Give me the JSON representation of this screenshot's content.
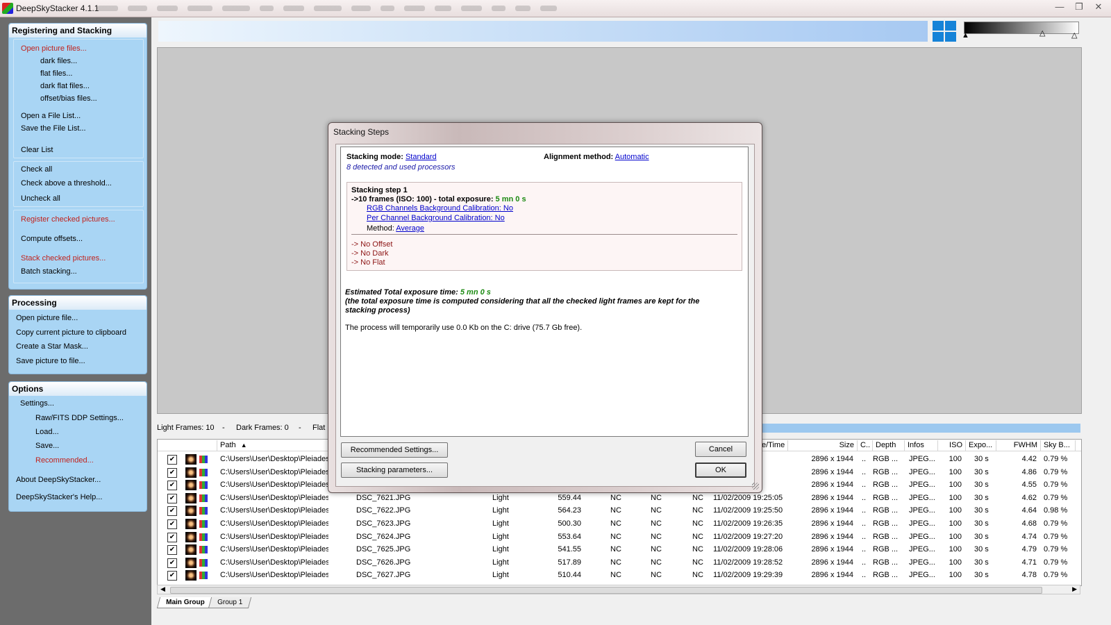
{
  "window": {
    "title": "DeepSkyStacker 4.1.1"
  },
  "sidebar": {
    "registering": {
      "title": "Registering and Stacking",
      "open_picture_files": "Open picture files...",
      "dark_files": "dark files...",
      "flat_files": "flat files...",
      "dark_flat_files": "dark flat files...",
      "offset_bias_files": "offset/bias files...",
      "open_file_list": "Open a File List...",
      "save_file_list": "Save the File List...",
      "clear_list": "Clear List",
      "check_all": "Check all",
      "check_above_threshold": "Check above a threshold...",
      "uncheck_all": "Uncheck all",
      "register_checked": "Register checked pictures...",
      "compute_offsets": "Compute offsets...",
      "stack_checked": "Stack checked pictures...",
      "batch_stacking": "Batch stacking..."
    },
    "processing": {
      "title": "Processing",
      "open_picture_file": "Open picture file...",
      "copy_to_clipboard": "Copy current picture to clipboard",
      "create_star_mask": "Create a Star Mask...",
      "save_picture": "Save picture to file..."
    },
    "options": {
      "title": "Options",
      "settings": "Settings...",
      "raw_fits": "Raw/FITS DDP Settings...",
      "load": "Load...",
      "save": "Save...",
      "recommended": "Recommended...",
      "about": "About DeepSkyStacker...",
      "help": "DeepSkyStacker's Help..."
    }
  },
  "frames_bar": {
    "light": "Light Frames: 10",
    "sep1": "-",
    "dark": "Dark Frames: 0",
    "sep2": "-",
    "flat": "Flat"
  },
  "table": {
    "headers": {
      "path": "Path",
      "datetime": "e/Time",
      "size": "Size",
      "c": "C..",
      "depth": "Depth",
      "infos": "Infos",
      "iso": "ISO",
      "expo": "Expo...",
      "fwhm": "FWHM",
      "skyb": "Sky B..."
    },
    "rows": [
      {
        "path": "C:\\Users\\User\\Desktop\\Pleiades\\",
        "file": "",
        "type": "",
        "score": "",
        "dx": "",
        "dy": "",
        "angle": "",
        "date": "22:31",
        "size": "2896 x 1944",
        "c": "..",
        "depth": "RGB ...",
        "infos": "JPEG...",
        "iso": "100",
        "expo": "30 s",
        "fwhm": "4.42",
        "skyb": "0.79 %"
      },
      {
        "path": "C:\\Users\\User\\Desktop\\Pleiades\\",
        "file": "",
        "type": "",
        "score": "",
        "dx": "",
        "dy": "",
        "angle": "",
        "date": "23:34",
        "size": "2896 x 1944",
        "c": "..",
        "depth": "RGB ...",
        "infos": "JPEG...",
        "iso": "100",
        "expo": "30 s",
        "fwhm": "4.86",
        "skyb": "0.79 %"
      },
      {
        "path": "C:\\Users\\User\\Desktop\\Pleiades\\",
        "file": "",
        "type": "",
        "score": "",
        "dx": "",
        "dy": "",
        "angle": "",
        "date": "24:20",
        "size": "2896 x 1944",
        "c": "..",
        "depth": "RGB ...",
        "infos": "JPEG...",
        "iso": "100",
        "expo": "30 s",
        "fwhm": "4.55",
        "skyb": "0.79 %"
      },
      {
        "path": "C:\\Users\\User\\Desktop\\Pleiades\\",
        "file": "DSC_7621.JPG",
        "type": "Light",
        "score": "559.44",
        "dx": "NC",
        "dy": "NC",
        "angle": "NC",
        "date": "11/02/2009 19:25:05",
        "size": "2896 x 1944",
        "c": "..",
        "depth": "RGB ...",
        "infos": "JPEG...",
        "iso": "100",
        "expo": "30 s",
        "fwhm": "4.62",
        "skyb": "0.79 %"
      },
      {
        "path": "C:\\Users\\User\\Desktop\\Pleiades\\",
        "file": "DSC_7622.JPG",
        "type": "Light",
        "score": "564.23",
        "dx": "NC",
        "dy": "NC",
        "angle": "NC",
        "date": "11/02/2009 19:25:50",
        "size": "2896 x 1944",
        "c": "..",
        "depth": "RGB ...",
        "infos": "JPEG...",
        "iso": "100",
        "expo": "30 s",
        "fwhm": "4.64",
        "skyb": "0.98 %"
      },
      {
        "path": "C:\\Users\\User\\Desktop\\Pleiades\\",
        "file": "DSC_7623.JPG",
        "type": "Light",
        "score": "500.30",
        "dx": "NC",
        "dy": "NC",
        "angle": "NC",
        "date": "11/02/2009 19:26:35",
        "size": "2896 x 1944",
        "c": "..",
        "depth": "RGB ...",
        "infos": "JPEG...",
        "iso": "100",
        "expo": "30 s",
        "fwhm": "4.68",
        "skyb": "0.79 %"
      },
      {
        "path": "C:\\Users\\User\\Desktop\\Pleiades\\",
        "file": "DSC_7624.JPG",
        "type": "Light",
        "score": "553.64",
        "dx": "NC",
        "dy": "NC",
        "angle": "NC",
        "date": "11/02/2009 19:27:20",
        "size": "2896 x 1944",
        "c": "..",
        "depth": "RGB ...",
        "infos": "JPEG...",
        "iso": "100",
        "expo": "30 s",
        "fwhm": "4.74",
        "skyb": "0.79 %"
      },
      {
        "path": "C:\\Users\\User\\Desktop\\Pleiades\\",
        "file": "DSC_7625.JPG",
        "type": "Light",
        "score": "541.55",
        "dx": "NC",
        "dy": "NC",
        "angle": "NC",
        "date": "11/02/2009 19:28:06",
        "size": "2896 x 1944",
        "c": "..",
        "depth": "RGB ...",
        "infos": "JPEG...",
        "iso": "100",
        "expo": "30 s",
        "fwhm": "4.79",
        "skyb": "0.79 %"
      },
      {
        "path": "C:\\Users\\User\\Desktop\\Pleiades\\",
        "file": "DSC_7626.JPG",
        "type": "Light",
        "score": "517.89",
        "dx": "NC",
        "dy": "NC",
        "angle": "NC",
        "date": "11/02/2009 19:28:52",
        "size": "2896 x 1944",
        "c": "..",
        "depth": "RGB ...",
        "infos": "JPEG...",
        "iso": "100",
        "expo": "30 s",
        "fwhm": "4.71",
        "skyb": "0.79 %"
      },
      {
        "path": "C:\\Users\\User\\Desktop\\Pleiades\\",
        "file": "DSC_7627.JPG",
        "type": "Light",
        "score": "510.44",
        "dx": "NC",
        "dy": "NC",
        "angle": "NC",
        "date": "11/02/2009 19:29:39",
        "size": "2896 x 1944",
        "c": "..",
        "depth": "RGB ...",
        "infos": "JPEG...",
        "iso": "100",
        "expo": "30 s",
        "fwhm": "4.78",
        "skyb": "0.79 %"
      }
    ]
  },
  "tabs": {
    "main": "Main Group",
    "group1": "Group 1"
  },
  "dialog": {
    "title": "Stacking Steps",
    "stacking_mode_label": "Stacking mode:",
    "stacking_mode_value": "Standard",
    "alignment_label": "Alignment method:",
    "alignment_value": "Automatic",
    "processors": "8 detected and used processors",
    "step_title": "Stacking step 1",
    "frames_line": "->10 frames (ISO: 100) - total exposure:",
    "frames_exposure": "5 mn 0 s",
    "rgb_calibration": "RGB Channels Background Calibration: No",
    "per_channel_calibration": "Per Channel Background Calibration: No",
    "method_label": "Method:",
    "method_value": "Average",
    "no_offset": "-> No Offset",
    "no_dark": "-> No Dark",
    "no_flat": "-> No Flat",
    "estimated_label": "Estimated Total exposure time:",
    "estimated_value": "5 mn 0 s",
    "note_line1": "(the total exposure time is computed considering that all the checked light frames are kept for the",
    "note_line2": "stacking process)",
    "disk_usage": "The process will temporarily use 0.0 Kb on the C: drive (75.7 Gb free).",
    "recommended_button": "Recommended Settings...",
    "parameters_button": "Stacking parameters...",
    "cancel_button": "Cancel",
    "ok_button": "OK"
  },
  "colors": {
    "panel_blue": "#a9d5f4",
    "link_red": "#c1221c",
    "exposure_green": "#1c8a12"
  }
}
